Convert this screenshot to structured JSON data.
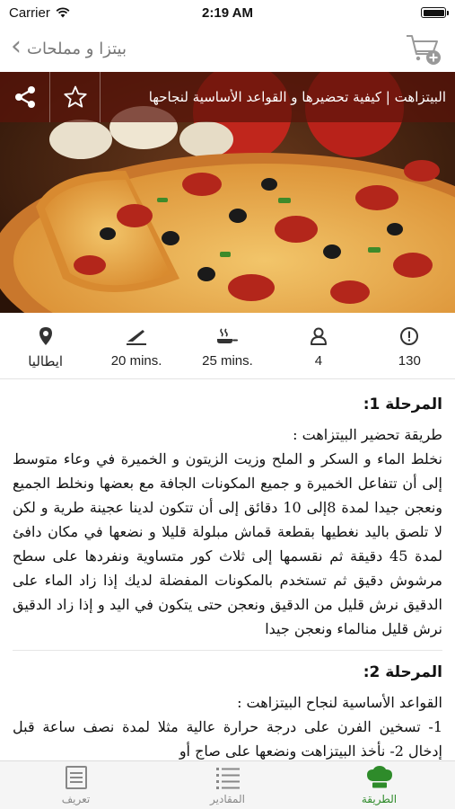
{
  "status": {
    "carrier": "Carrier",
    "time": "2:19 AM",
    "battery_level": 1.0
  },
  "nav": {
    "back_label": "بيتزا و مملحات"
  },
  "colors": {
    "accent": "#2e8b2a",
    "title_bar": "#5a140a"
  },
  "recipe": {
    "title": "البيتزاهت | كيفية تحضيرها و القواعد الأساسية لنجاحها",
    "info": {
      "origin": "ايطاليا",
      "prep_time": "20 mins.",
      "cook_time": "25 mins.",
      "servings": "4",
      "calories": "130"
    },
    "stages": [
      {
        "title": "المرحلة 1:",
        "lines": [
          "طريقة تحضير البيتزاهت :",
          "نخلط الماء و السكر و الملح وزيت الزيتون و الخميرة في وعاء متوسط إلى أن تتفاعل الخميرة و جميع المكونات الجافة مع بعضها ونخلط الجميع ونعجن جيدا لمدة 8إلى 10 دقائق إلى أن تتكون لدينا عجينة طرية و لكن لا تلصق باليد نغطيها بقطعة قماش مبلولة قليلا و نضعها في مكان دافئ لمدة 45 دقيقة ثم نقسمها إلى ثلاث كور متساوية ونفردها على سطح مرشوش دقيق ثم تستخدم بالمكونات المفضلة لديك إذا زاد الماء على الدقيق نرش قليل من الدقيق ونعجن حتى يتكون في اليد و إذا زاد الدقيق نرش قليل منالماء ونعجن جيدا"
        ]
      },
      {
        "title": "المرحلة 2:",
        "lines": [
          "القواعد الأساسية لنجاح البيتزاهت :",
          "1- تسخين الفرن على درجة حرارة عالية مثلا لمدة نصف ساعة قبل إدخال 2- نأخذ البيتزاهت ونضعها على صاج أو"
        ]
      }
    ]
  },
  "tabs": [
    {
      "label": "الطريقة",
      "icon": "chef-hat-icon",
      "active": true
    },
    {
      "label": "المقادير",
      "icon": "list-icon",
      "active": false
    },
    {
      "label": "تعريف",
      "icon": "document-icon",
      "active": false
    }
  ]
}
